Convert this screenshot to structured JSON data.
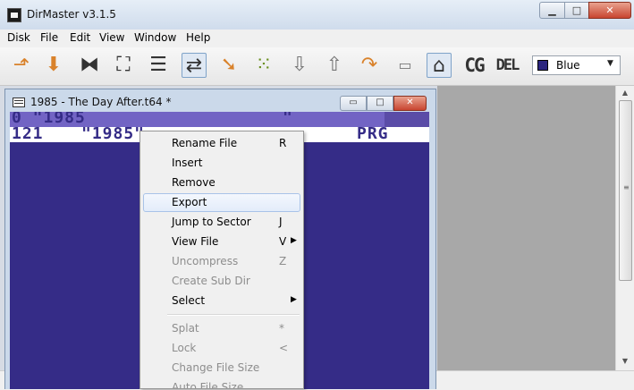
{
  "app": {
    "title": "DirMaster v3.1.5",
    "controls": {
      "minimize": "▁",
      "maximize": "□",
      "close": "✕"
    }
  },
  "menubar": {
    "items": [
      "Disk",
      "File",
      "Edit",
      "View",
      "Window",
      "Help"
    ]
  },
  "toolbar": {
    "buttons": [
      "open-disk-icon",
      "save-disk-icon",
      "block-editor-icon",
      "bam-icon",
      "directory-list-icon",
      "file-convert-icon",
      "export-icon",
      "grid-icon",
      "move-down-icon",
      "move-up-icon",
      "redo-icon",
      "folder-icon",
      "rename-icon",
      "cg-icon",
      "del-icon"
    ],
    "cg_label": "CG",
    "del_label": "DEL",
    "color_select": {
      "value": "Blue",
      "swatch_color": "#2b257f"
    }
  },
  "child_window": {
    "title": "1985 - The Day After.t64 *",
    "controls": {
      "minimize": "▭",
      "maximize": "□",
      "close": "✕"
    }
  },
  "listing": {
    "header_text": "0 \"1985",
    "header_tail": "\"",
    "row": {
      "blocks": "121",
      "name": "\"1985\"",
      "type": "PRG"
    },
    "colors": {
      "background": "#352c87",
      "header": "#7264c4",
      "text": "#ffffff"
    }
  },
  "context_menu": {
    "items": [
      {
        "label": "Rename File",
        "shortcut": "R",
        "disabled": false,
        "submenu": false
      },
      {
        "label": "Insert",
        "shortcut": "",
        "disabled": false,
        "submenu": false
      },
      {
        "label": "Remove",
        "shortcut": "",
        "disabled": false,
        "submenu": false
      },
      {
        "label": "Export",
        "shortcut": "",
        "disabled": false,
        "submenu": false,
        "highlighted": true
      },
      {
        "label": "Jump to Sector",
        "shortcut": "J",
        "disabled": false,
        "submenu": false
      },
      {
        "label": "View File",
        "shortcut": "V",
        "disabled": false,
        "submenu": true
      },
      {
        "label": "Uncompress",
        "shortcut": "Z",
        "disabled": true,
        "submenu": false
      },
      {
        "label": "Create Sub Dir",
        "shortcut": "",
        "disabled": true,
        "submenu": false
      },
      {
        "label": "Select",
        "shortcut": "",
        "disabled": false,
        "submenu": true
      },
      {
        "label": "Splat",
        "shortcut": "*",
        "disabled": true,
        "submenu": false
      },
      {
        "label": "Lock",
        "shortcut": "<",
        "disabled": true,
        "submenu": false
      },
      {
        "label": "Change File Size",
        "shortcut": "",
        "disabled": true,
        "submenu": false
      },
      {
        "label": "Auto File Size",
        "shortcut": "",
        "disabled": true,
        "submenu": false
      }
    ]
  }
}
